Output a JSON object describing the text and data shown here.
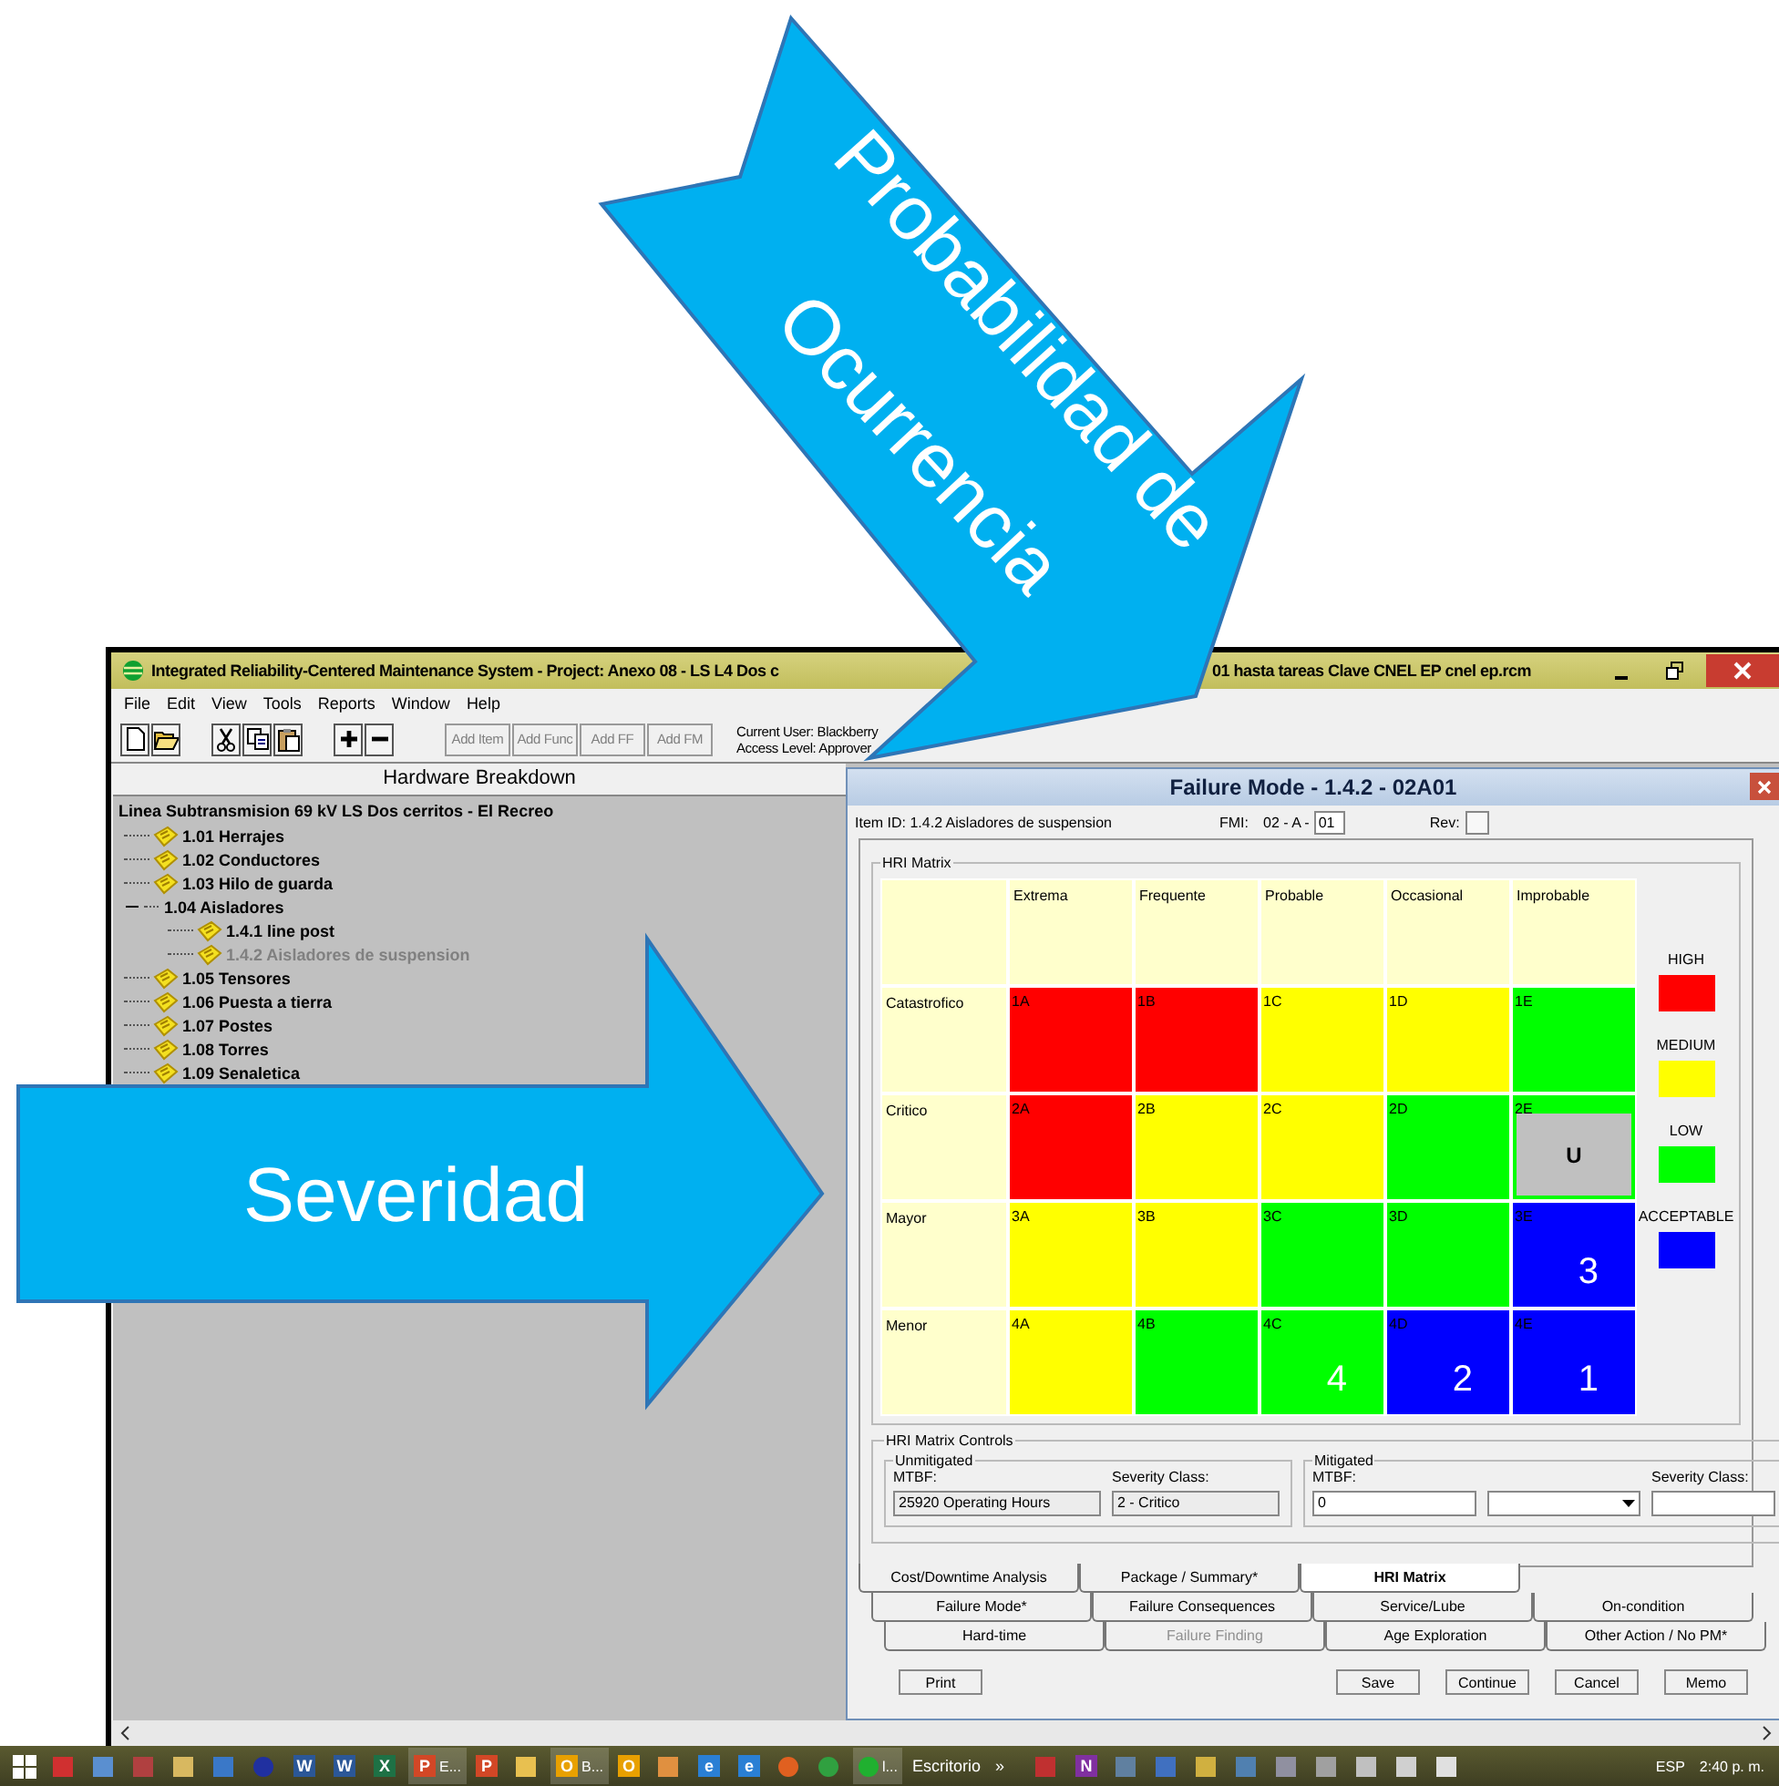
{
  "window": {
    "title_parts": [
      "Integrated Reliability-Centered Maintenance System  -  Project: Anexo 08 - LS L4 Dos c",
      "01 hasta tareas Clave  CNEL EP cnel ep.rcm"
    ],
    "menu": [
      "File",
      "Edit",
      "View",
      "Tools",
      "Reports",
      "Window",
      "Help"
    ],
    "icon_buttons": [
      {
        "kind": "new"
      },
      {
        "kind": "open"
      },
      {
        "kind": "cut"
      },
      {
        "kind": "copy"
      },
      {
        "kind": "paste"
      },
      {
        "kind": "plus"
      },
      {
        "kind": "minus"
      }
    ],
    "text_buttons": [
      {
        "label": "Add Item",
        "disabled": true
      },
      {
        "label": "Add Func",
        "disabled": true
      },
      {
        "label": "Add FF",
        "disabled": true
      },
      {
        "label": "Add FM",
        "disabled": true
      }
    ],
    "user": "Current User: Blackberry",
    "access": "Access Level: Approver"
  },
  "tree": {
    "header": "Hardware Breakdown",
    "root": "Linea Subtransmision 69 kV  LS Dos cerritos - El Recreo",
    "children": [
      {
        "label": "1.01  Herrajes",
        "kind": "item",
        "disabled": false
      },
      {
        "label": "1.02  Conductores",
        "kind": "item",
        "disabled": false
      },
      {
        "label": "1.03  Hilo de guarda",
        "kind": "item",
        "disabled": false
      },
      {
        "label": "1.04  Aisladores",
        "kind": "group",
        "expanded": true,
        "disabled": false,
        "children": [
          {
            "label": "1.4.1  line post",
            "kind": "item",
            "disabled": false
          },
          {
            "label": "1.4.2  Aisladores de suspension",
            "kind": "item",
            "disabled": true
          }
        ]
      },
      {
        "label": "1.05  Tensores",
        "kind": "item",
        "disabled": false
      },
      {
        "label": "1.06  Puesta a tierra",
        "kind": "item",
        "disabled": false
      },
      {
        "label": "1.07  Postes",
        "kind": "item",
        "disabled": false
      },
      {
        "label": "1.08  Torres",
        "kind": "item",
        "disabled": false
      },
      {
        "label": "1.09  Senaletica",
        "kind": "item",
        "disabled": false
      }
    ]
  },
  "dialog": {
    "title": "Failure Mode - 1.4.2 - 02A01",
    "item_id": "Item ID: 1.4.2 Aisladores de suspension",
    "fmi_label": "FMI:",
    "fmi_prefix": "02 - A -",
    "fmi_value": "01",
    "rev_label": "Rev:",
    "matrix": {
      "title": "HRI Matrix",
      "columns": [
        "Extrema",
        "Frequente",
        "Probable",
        "Occasional",
        "Improbable"
      ],
      "rows": [
        {
          "label": "Catastrofico",
          "cells": [
            {
              "code": "1A",
              "color": "#ff0000"
            },
            {
              "code": "1B",
              "color": "#ff0000"
            },
            {
              "code": "1C",
              "color": "#ffff00"
            },
            {
              "code": "1D",
              "color": "#ffff00"
            },
            {
              "code": "1E",
              "color": "#00ff00"
            }
          ]
        },
        {
          "label": "Critico",
          "cells": [
            {
              "code": "2A",
              "color": "#ff0000"
            },
            {
              "code": "2B",
              "color": "#ffff00"
            },
            {
              "code": "2C",
              "color": "#ffff00"
            },
            {
              "code": "2D",
              "color": "#00ff00"
            },
            {
              "code": "2E",
              "color": "#00ff00",
              "overlay": "U"
            }
          ]
        },
        {
          "label": "Mayor",
          "cells": [
            {
              "code": "3A",
              "color": "#ffff00"
            },
            {
              "code": "3B",
              "color": "#ffff00"
            },
            {
              "code": "3C",
              "color": "#00ff00"
            },
            {
              "code": "3D",
              "color": "#00ff00"
            },
            {
              "code": "3E",
              "color": "#0000ff",
              "marker": "3"
            }
          ]
        },
        {
          "label": "Menor",
          "cells": [
            {
              "code": "4A",
              "color": "#ffff00"
            },
            {
              "code": "4B",
              "color": "#00ff00"
            },
            {
              "code": "4C",
              "color": "#00ff00",
              "marker": "4"
            },
            {
              "code": "4D",
              "color": "#0000ff",
              "marker": "2"
            },
            {
              "code": "4E",
              "color": "#0000ff",
              "marker": "1"
            }
          ]
        }
      ],
      "legend": [
        {
          "label": "HIGH",
          "color": "#ff0000"
        },
        {
          "label": "MEDIUM",
          "color": "#ffff00"
        },
        {
          "label": "LOW",
          "color": "#00ff00"
        },
        {
          "label": "ACCEPTABLE",
          "color": "#0000ff"
        }
      ]
    },
    "controls": {
      "title": "HRI Matrix Controls",
      "unmitigated": {
        "title": "Unmitigated",
        "mtbf_label": "MTBF:",
        "mtbf": "25920 Operating Hours",
        "severity_label": "Severity Class:",
        "severity": "2 - Critico"
      },
      "mitigated": {
        "title": "Mitigated",
        "mtbf_label": "MTBF:",
        "mtbf": "0",
        "severity_label": "Severity Class:"
      }
    },
    "tabs": [
      [
        {
          "label": "Cost/Downtime Analysis",
          "selected": false,
          "disabled": false
        },
        {
          "label": "Package / Summary*",
          "selected": false,
          "disabled": false
        },
        {
          "label": "HRI Matrix",
          "selected": true,
          "disabled": false
        }
      ],
      [
        {
          "label": "Failure Mode*",
          "selected": false,
          "disabled": false
        },
        {
          "label": "Failure Consequences",
          "selected": false,
          "disabled": false
        },
        {
          "label": "Service/Lube",
          "selected": false,
          "disabled": false
        },
        {
          "label": "On-condition",
          "selected": false,
          "disabled": false
        }
      ],
      [
        {
          "label": "Hard-time",
          "selected": false,
          "disabled": false
        },
        {
          "label": "Failure Finding",
          "selected": false,
          "disabled": true
        },
        {
          "label": "Age Exploration",
          "selected": false,
          "disabled": false
        },
        {
          "label": "Other Action / No PM*",
          "selected": false,
          "disabled": false
        }
      ]
    ],
    "buttons": [
      "Print",
      "Save",
      "Continue",
      "Cancel",
      "Memo"
    ]
  },
  "annotations": [
    {
      "kind": "arrow-down-right",
      "lines": [
        "Probabilidad de",
        "Ocurrencia"
      ]
    },
    {
      "kind": "arrow-right",
      "lines": [
        "Severidad"
      ]
    }
  ],
  "taskbar": {
    "items": [
      {
        "kind": "start"
      },
      {
        "kind": "square",
        "color": "#d03030"
      },
      {
        "kind": "square",
        "color": "#5a8fd0"
      },
      {
        "kind": "square",
        "color": "#b04040"
      },
      {
        "kind": "square",
        "color": "#d8b860"
      },
      {
        "kind": "square",
        "color": "#3a78c8"
      },
      {
        "kind": "round",
        "color": "#2030a0"
      },
      {
        "kind": "app",
        "glyph": "W",
        "color": "#2b5797"
      },
      {
        "kind": "app",
        "glyph": "W",
        "color": "#2b5797"
      },
      {
        "kind": "app",
        "glyph": "X",
        "color": "#1e7145"
      },
      {
        "kind": "app",
        "glyph": "P",
        "color": "#d24726",
        "label": "E..."
      },
      {
        "kind": "app",
        "glyph": "P",
        "color": "#d24726"
      },
      {
        "kind": "square",
        "color": "#e8c050"
      },
      {
        "kind": "app",
        "glyph": "O",
        "color": "#e8a000",
        "label": "B..."
      },
      {
        "kind": "app",
        "glyph": "O",
        "color": "#e8a000"
      },
      {
        "kind": "square",
        "color": "#e09040"
      },
      {
        "kind": "app",
        "glyph": "e",
        "color": "#2a7fd4"
      },
      {
        "kind": "app",
        "glyph": "e",
        "color": "#2a7fd4"
      },
      {
        "kind": "round",
        "color": "#e06020"
      },
      {
        "kind": "round",
        "color": "#30a040"
      },
      {
        "kind": "round",
        "color": "#20b030",
        "label": "l..."
      },
      {
        "kind": "text",
        "label": "Escritorio"
      },
      {
        "kind": "text",
        "label": "»"
      },
      {
        "kind": "square",
        "color": "#c03030"
      },
      {
        "kind": "app",
        "glyph": "N",
        "color": "#8030a0"
      },
      {
        "kind": "square",
        "color": "#6080a0"
      },
      {
        "kind": "square",
        "color": "#4070c0"
      },
      {
        "kind": "square",
        "color": "#d0b040"
      },
      {
        "kind": "square",
        "color": "#5080b0"
      },
      {
        "kind": "square",
        "color": "#9090a0"
      },
      {
        "kind": "square",
        "color": "#a0a0a0"
      },
      {
        "kind": "square",
        "color": "#c0c0c0"
      },
      {
        "kind": "square",
        "color": "#d0d0d0"
      },
      {
        "kind": "square",
        "color": "#e0e0e0"
      }
    ],
    "language": "ESP",
    "clock": "2:40 p. m."
  }
}
